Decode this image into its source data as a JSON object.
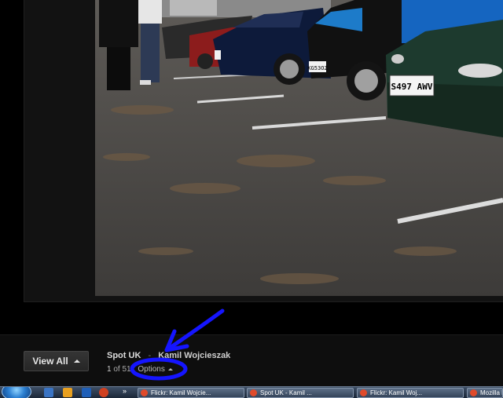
{
  "viewer": {
    "view_all_label": "View All",
    "album_title": "Spot UK",
    "author_name": "Kamil Wojcieszak",
    "counter_current": "1",
    "counter_total": "of 51",
    "options_label": "Options"
  },
  "photo": {
    "plates": [
      "S497 AWV",
      "KG53OZ"
    ]
  },
  "taskbar": {
    "more_label": "»",
    "items": [
      {
        "label": "Flickr: Kamil Wojcie..."
      },
      {
        "label": "Spot UK - Kamil ..."
      },
      {
        "label": "Flickr: Kamil Woj..."
      },
      {
        "label": "Mozilla Firefox"
      }
    ]
  },
  "colors": {
    "annotation": "#1515ff",
    "background": "#000000",
    "bar": "#0e0e0e"
  }
}
